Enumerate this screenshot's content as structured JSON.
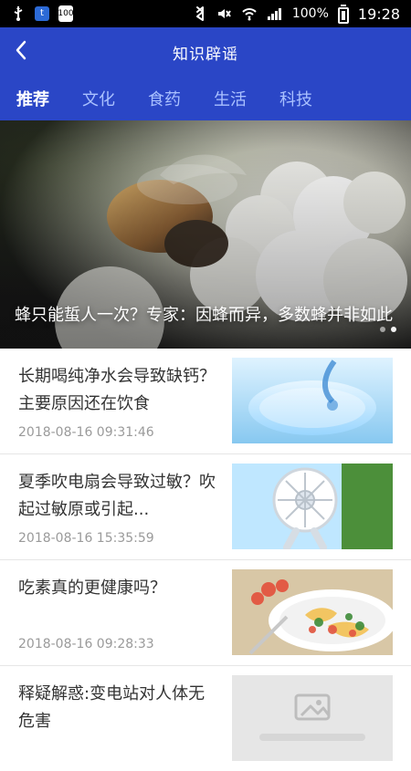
{
  "statusbar": {
    "battery_percent_label": "100%",
    "time": "19:28",
    "mini_badge_text": "100",
    "icons": [
      "usb-icon",
      "app-icon",
      "battery-badge-icon",
      "bluetooth-icon",
      "mute-icon",
      "wifi-icon",
      "signal-icon",
      "battery-icon"
    ]
  },
  "header": {
    "title": "知识辟谣",
    "back_icon": "chevron-left-icon",
    "tabs": [
      {
        "label": "推荐",
        "active": true
      },
      {
        "label": "文化",
        "active": false
      },
      {
        "label": "食药",
        "active": false
      },
      {
        "label": "生活",
        "active": false
      },
      {
        "label": "科技",
        "active": false
      }
    ],
    "colors": {
      "header_bg": "#2a46c6",
      "tab_inactive": "#a9c0ff",
      "tab_active": "#ffffff"
    }
  },
  "hero": {
    "title": "蜂只能蜇人一次？专家：因蜂而异，多数蜂并非如此",
    "carousel_index": 2,
    "carousel_count": 2
  },
  "articles": [
    {
      "title": "长期喝纯净水会导致缺钙？主要原因还在饮食",
      "time": "2018-08-16 09:31:46",
      "thumb": "water-glass"
    },
    {
      "title": "夏季吹电扇会导致过敏？吹起过敏原或引起...",
      "time": "2018-08-16 15:35:59",
      "thumb": "electric-fan"
    },
    {
      "title": "吃素真的更健康吗？",
      "time": "2018-08-16 09:28:33",
      "thumb": "salad-plate"
    },
    {
      "title": "释疑解惑:变电站对人体无危害",
      "time": "",
      "thumb": "placeholder"
    }
  ]
}
